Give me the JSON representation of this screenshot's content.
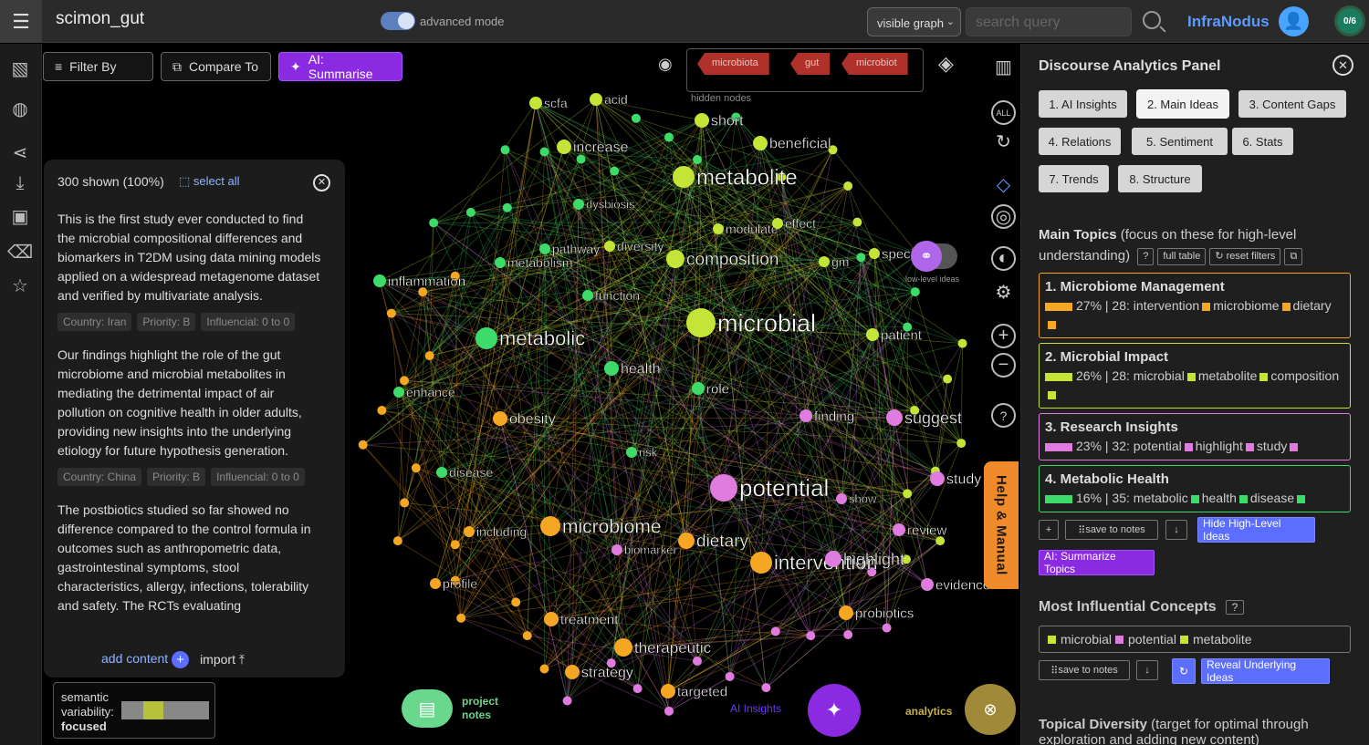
{
  "app": {
    "title": "scimon_gut",
    "brand": "InfraNodus",
    "advanced_mode": "advanced mode",
    "visible_select": "visible graph",
    "search_placeholder": "search query",
    "count_badge": "0/6"
  },
  "toolbar": {
    "filter": "Filter By",
    "compare": "Compare To",
    "summarise": "AI: Summarise"
  },
  "hidden_nodes": {
    "label": "hidden nodes",
    "tags": [
      "microbiota",
      "gut",
      "microbiot"
    ]
  },
  "text_panel": {
    "shown": "300 shown (100%)",
    "select_all": "select all",
    "entries": [
      {
        "text": "This is the first study ever conducted to find the microbial compositional differences and biomarkers in T2DM using data mining models applied on a widespread metagenome dataset and verified by multivariate analysis.",
        "tags": [
          "Country: Iran",
          "Priority: B",
          "Influencial: 0 to 0"
        ]
      },
      {
        "text": "Our findings highlight the role of the gut microbiome and microbial metabolites in mediating the detrimental impact of air pollution on cognitive health in older adults, providing new insights into the underlying etiology for future hypothesis generation.",
        "tags": [
          "Country: China",
          "Priority: B",
          "Influencial: 0 to 0"
        ]
      },
      {
        "text": "The postbiotics studied so far showed no difference compared to the control formula in outcomes such as anthropometric data, gastrointestinal symptoms, stool characteristics, allergy, infections, tolerability and safety. The RCTs evaluating",
        "tags": []
      }
    ],
    "add_content": "add content",
    "import": "import"
  },
  "semantic": {
    "label1": "semantic",
    "label2": "variability:",
    "value": "focused"
  },
  "bottom": {
    "project_notes_1": "project",
    "project_notes_2": "notes",
    "ai_insights": "AI Insights",
    "analytics": "analytics"
  },
  "help": "Help & Manual",
  "low_level": "low-level ideas",
  "colors": {
    "green": "#3ddc6a",
    "lime": "#c4e538",
    "orange": "#f5a623",
    "pink": "#e07be0",
    "accent_purple": "#8a2be2",
    "accent_blue": "#5b6eff"
  },
  "graph": {
    "nodes": [
      {
        "label": "scfa",
        "c": "lime"
      },
      {
        "label": "acid",
        "c": "lime"
      },
      {
        "label": "short",
        "c": "lime"
      },
      {
        "label": "increase",
        "c": "lime"
      },
      {
        "label": "beneficial",
        "c": "lime"
      },
      {
        "label": "metabolite",
        "c": "lime"
      },
      {
        "label": "dysbiosis",
        "c": "green"
      },
      {
        "label": "modulate",
        "c": "lime"
      },
      {
        "label": "effect",
        "c": "lime"
      },
      {
        "label": "pathway",
        "c": "green"
      },
      {
        "label": "diversity",
        "c": "lime"
      },
      {
        "label": "metabolism",
        "c": "green"
      },
      {
        "label": "composition",
        "c": "lime"
      },
      {
        "label": "gm",
        "c": "lime"
      },
      {
        "label": "speci",
        "c": "lime"
      },
      {
        "label": "inflammation",
        "c": "green"
      },
      {
        "label": "function",
        "c": "green"
      },
      {
        "label": "microbial",
        "c": "lime"
      },
      {
        "label": "patient",
        "c": "lime"
      },
      {
        "label": "metabolic",
        "c": "green"
      },
      {
        "label": "health",
        "c": "green"
      },
      {
        "label": "role",
        "c": "green"
      },
      {
        "label": "enhance",
        "c": "green"
      },
      {
        "label": "finding",
        "c": "pink"
      },
      {
        "label": "suggest",
        "c": "pink"
      },
      {
        "label": "obesity",
        "c": "orange"
      },
      {
        "label": "risk",
        "c": "green"
      },
      {
        "label": "disease",
        "c": "green"
      },
      {
        "label": "potential",
        "c": "pink"
      },
      {
        "label": "study",
        "c": "pink"
      },
      {
        "label": "show",
        "c": "pink"
      },
      {
        "label": "including",
        "c": "orange"
      },
      {
        "label": "microbiome",
        "c": "orange"
      },
      {
        "label": "review",
        "c": "pink"
      },
      {
        "label": "dietary",
        "c": "orange"
      },
      {
        "label": "biomarker",
        "c": "pink"
      },
      {
        "label": "intervention",
        "c": "orange"
      },
      {
        "label": "highlight",
        "c": "pink"
      },
      {
        "label": "evidence",
        "c": "pink"
      },
      {
        "label": "profile",
        "c": "orange"
      },
      {
        "label": "treatment",
        "c": "orange"
      },
      {
        "label": "probiotics",
        "c": "orange"
      },
      {
        "label": "therapeutic",
        "c": "orange"
      },
      {
        "label": "strategy",
        "c": "orange"
      },
      {
        "label": "targeted",
        "c": "orange"
      }
    ]
  },
  "analytics_panel": {
    "title": "Discourse Analytics Panel",
    "tabs": [
      "1. AI Insights",
      "2. Main Ideas",
      "3. Content Gaps",
      "4. Relations",
      "5. Sentiment",
      "6. Stats",
      "7. Trends",
      "8. Structure"
    ],
    "main_topics_title": "Main Topics",
    "main_topics_note": "(focus on these for high-level understanding)",
    "q": "?",
    "full_table": "full table",
    "reset_filters": "↻ reset filters",
    "topics": [
      {
        "name": "1. Microbiome Management",
        "stats": "27% | 28:",
        "terms": [
          "intervention",
          "microbiome",
          "dietary"
        ],
        "c": "orange"
      },
      {
        "name": "2. Microbial Impact",
        "stats": "26% | 28:",
        "terms": [
          "microbial",
          "metabolite",
          "composition"
        ],
        "c": "lime"
      },
      {
        "name": "3. Research Insights",
        "stats": "23% | 32:",
        "terms": [
          "potential",
          "highlight",
          "study"
        ],
        "c": "pink"
      },
      {
        "name": "4. Metabolic Health",
        "stats": "16% | 35:",
        "terms": [
          "metabolic",
          "health",
          "disease"
        ],
        "c": "green"
      }
    ],
    "plus": "+",
    "save_notes": "save to notes",
    "down": "↓",
    "hide_high": "Hide High-Level Ideas",
    "ai_summ_topics": "AI: Summarize Topics",
    "influential_title": "Most Influential Concepts",
    "influential": [
      {
        "t": "microbial",
        "c": "lime"
      },
      {
        "t": "potential",
        "c": "pink"
      },
      {
        "t": "metabolite",
        "c": "lime"
      }
    ],
    "save_notes2": "save to notes",
    "reveal": "Reveal Underlying Ideas",
    "refresh": "↻",
    "diversity_title": "Topical Diversity",
    "diversity_note": "(target for optimal through exploration and adding new content)"
  }
}
